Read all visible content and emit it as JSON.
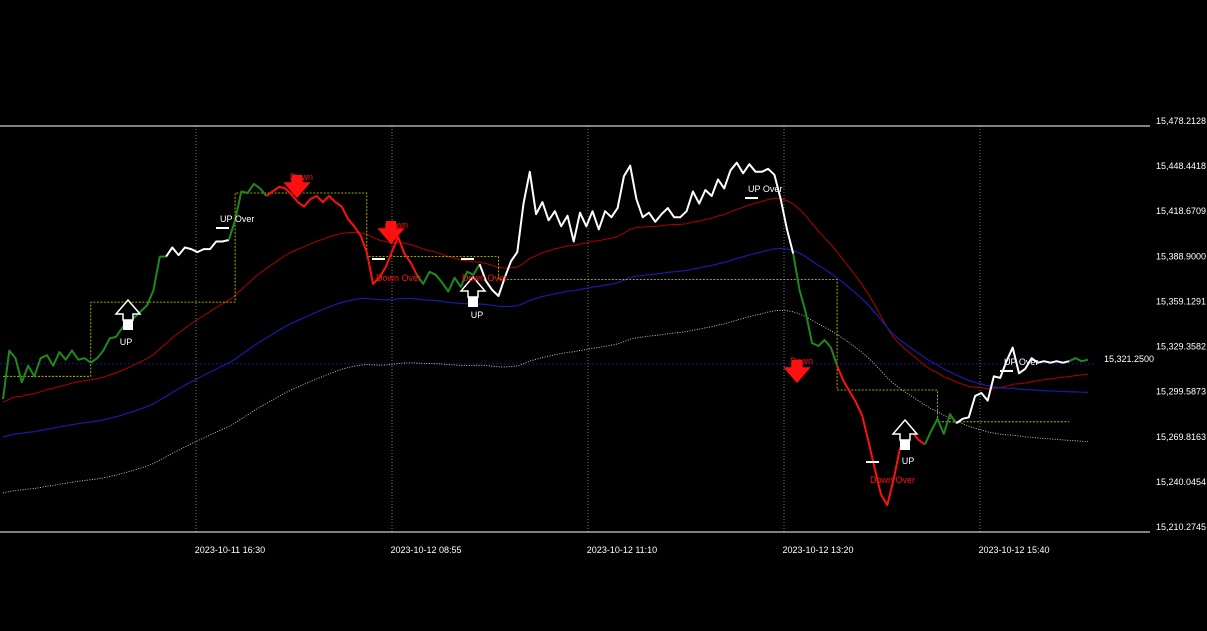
{
  "chart_data": {
    "type": "line",
    "title": "",
    "xlabel": "",
    "ylabel": "",
    "ylim": [
      15210.2745,
      15478.2128
    ],
    "y_ticks": [
      "15,478.2128",
      "15,448.4418",
      "15,418.6709",
      "15,388.9000",
      "15,359.1291",
      "15,329.3582",
      "15,299.5873",
      "15,269.8163",
      "15,240.0454",
      "15,210.2745"
    ],
    "y_tick_values": [
      15478.2128,
      15448.4418,
      15418.6709,
      15388.9,
      15359.1291,
      15329.3582,
      15299.5873,
      15269.8163,
      15240.0454,
      15210.2745
    ],
    "x_ticks": [
      "2023-10-11 16:30",
      "2023-10-12 08:55",
      "2023-10-12 11:10",
      "2023-10-12 13:20",
      "2023-10-12 15:40"
    ],
    "current_price": 15321.25,
    "current_price_label": "15,321.2500",
    "grid": true,
    "colors": {
      "background": "#000000",
      "up": "#1e8a1e",
      "down": "#ff1010",
      "neutral": "#ffffff",
      "ma_red": "#b00000",
      "ma_blue": "#1a1aa8",
      "band_white": "#cfcfcf",
      "stop_yellow": "#d8d800",
      "grid": "#ffffff",
      "price_line": "#2020c0"
    },
    "series": [
      {
        "role": "price",
        "values": [
          15298,
          15330,
          15325,
          15309,
          15320,
          15313,
          15325,
          15327,
          15320,
          15329,
          15324,
          15330,
          15324,
          15325,
          15322,
          15325,
          15330,
          15338,
          15339,
          15345,
          15350,
          15352,
          15356,
          15360,
          15370,
          15392,
          15392,
          15398,
          15393,
          15398,
          15397,
          15395,
          15397,
          15397,
          15402,
          15402,
          15403,
          15416,
          15435,
          15434,
          15440,
          15437,
          15432,
          15435,
          15438,
          15437,
          15433,
          15428,
          15425,
          15430,
          15432,
          15428,
          15432,
          15428,
          15425,
          15417,
          15412,
          15406,
          15395,
          15374,
          15378,
          15385,
          15395,
          15405,
          15394,
          15388,
          15380,
          15374,
          15382,
          15380,
          15375,
          15369,
          15378,
          15372,
          15382,
          15380,
          15387,
          15376,
          15370,
          15366,
          15378,
          15389,
          15395,
          15427,
          15448,
          15420,
          15428,
          15416,
          15422,
          15412,
          15419,
          15402,
          15421,
          15412,
          15422,
          15410,
          15422,
          15418,
          15424,
          15445,
          15452,
          15430,
          15418,
          15421,
          15415,
          15420,
          15424,
          15418,
          15418,
          15422,
          15435,
          15427,
          15436,
          15432,
          15443,
          15437,
          15449,
          15454,
          15447,
          15453,
          15448,
          15448,
          15450,
          15446,
          15430,
          15410,
          15394,
          15370,
          15355,
          15335,
          15333,
          15337,
          15332,
          15320,
          15310,
          15303,
          15296,
          15287,
          15270,
          15252,
          15235,
          15228,
          15245,
          15265,
          15273,
          15276,
          15271,
          15268,
          15277,
          15285,
          15275,
          15288,
          15282,
          15285,
          15286,
          15300,
          15302,
          15297,
          15313,
          15312,
          15323,
          15332,
          15315,
          15318,
          15325,
          15322,
          15323,
          15322,
          15323,
          15322,
          15323,
          15325,
          15323,
          15324
        ]
      },
      {
        "role": "ma-red",
        "start": 15300,
        "end": 15320
      },
      {
        "role": "ma-blue",
        "start": 15275,
        "end": 15283
      },
      {
        "role": "band-lower",
        "start": 15220,
        "end": 15245
      }
    ],
    "annotations": [
      {
        "text": "UP",
        "color": "#ffffff"
      },
      {
        "text": "UP Over",
        "color": "#ffffff"
      },
      {
        "text": "Down",
        "color": "#ff1010"
      },
      {
        "text": "Down",
        "color": "#ff1010"
      },
      {
        "text": "Down Over",
        "color": "#ff1010"
      },
      {
        "text": "UP",
        "color": "#ffffff"
      },
      {
        "text": "Down Over",
        "color": "#ff1010"
      },
      {
        "text": "UP Over",
        "color": "#ffffff"
      },
      {
        "text": "Down",
        "color": "#ff1010"
      },
      {
        "text": "Down Over",
        "color": "#ff1010"
      },
      {
        "text": "UP",
        "color": "#ffffff"
      },
      {
        "text": "UP Over",
        "color": "#ffffff"
      }
    ],
    "signals": [
      {
        "type": "up-arrow"
      },
      {
        "type": "down-arrow"
      },
      {
        "type": "down-arrow"
      },
      {
        "type": "up-arrow"
      },
      {
        "type": "down-arrow"
      },
      {
        "type": "up-arrow"
      }
    ]
  }
}
